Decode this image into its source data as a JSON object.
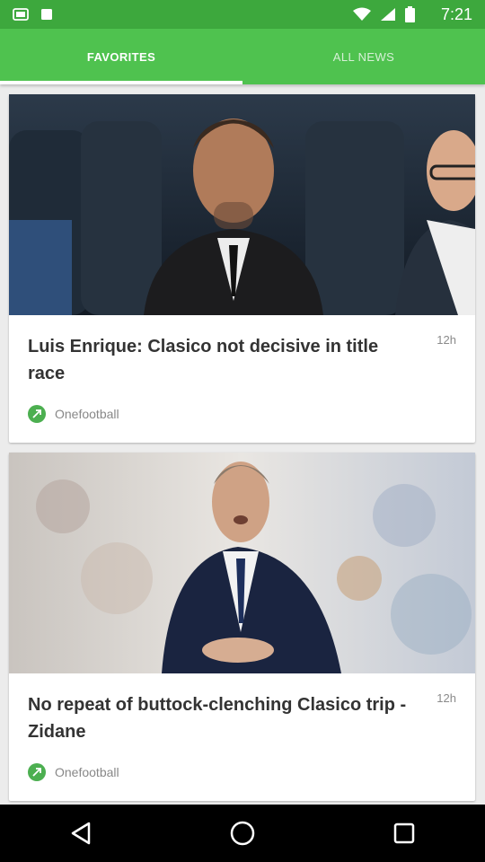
{
  "status_bar": {
    "time": "7:21"
  },
  "tabs": [
    {
      "label": "FAVORITES",
      "active": true
    },
    {
      "label": "ALL NEWS",
      "active": false
    }
  ],
  "articles": [
    {
      "title": "Luis Enrique: Clasico not decisive in title race",
      "age": "12h",
      "source": "Onefootball"
    },
    {
      "title": "No repeat of buttock-clenching Clasico trip - Zidane",
      "age": "12h",
      "source": "Onefootball"
    }
  ],
  "colors": {
    "status_bar": "#3da83d",
    "tab_bar": "#4fc24f",
    "source_icon": "#4caf50"
  },
  "navigation": {
    "back_icon": "back-triangle-icon",
    "home_icon": "home-circle-icon",
    "recents_icon": "recents-square-icon"
  }
}
